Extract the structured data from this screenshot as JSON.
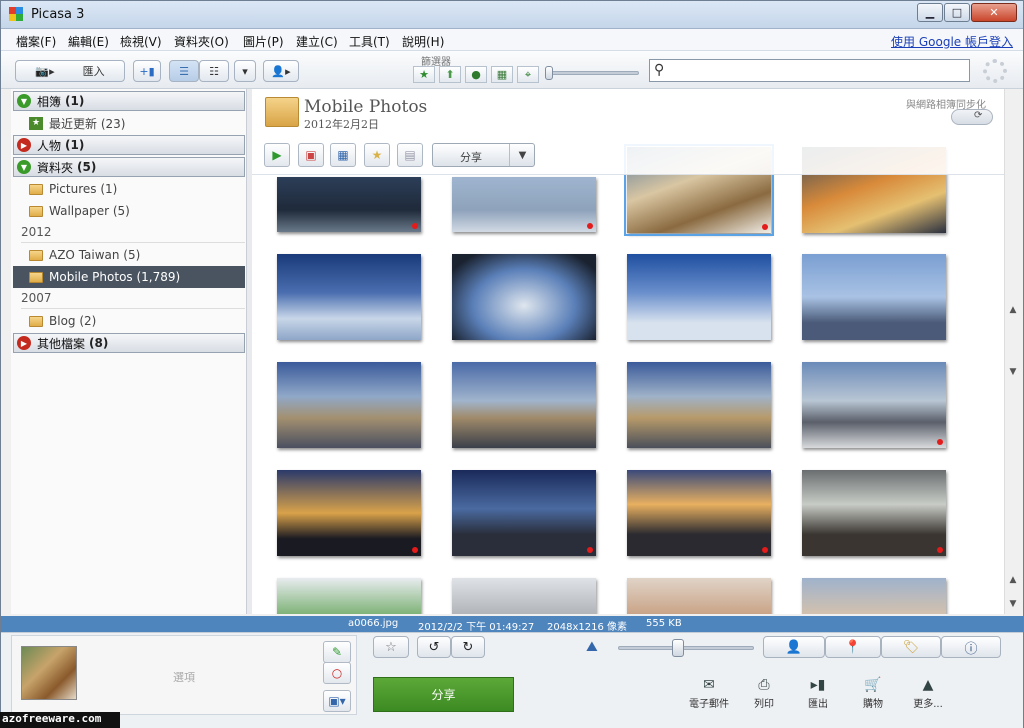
{
  "window": {
    "title": "Picasa 3",
    "controls": [
      "minimize",
      "maximize",
      "close"
    ]
  },
  "menu": {
    "items": [
      "檔案(F)",
      "編輯(E)",
      "檢視(V)",
      "資料夾(O)",
      "圖片(P)",
      "建立(C)",
      "工具(T)",
      "說明(H)"
    ],
    "login": "使用 Google 帳戶登入"
  },
  "toolbar": {
    "import_label": "匯入",
    "filter_label": "篩選器",
    "search_placeholder": "",
    "filter_icons": [
      "star-filter-icon",
      "upload-filter-icon",
      "person-filter-icon",
      "movie-filter-icon",
      "geotag-filter-icon"
    ]
  },
  "sidebar": {
    "sections": [
      {
        "label": "相簿",
        "count": "(1)",
        "expanded": true,
        "color": "#3a9a2a"
      },
      {
        "label": "人物",
        "count": "(1)",
        "expanded": false,
        "color": "#c42a1e"
      },
      {
        "label": "資料夾",
        "count": "(5)",
        "expanded": true,
        "color": "#3a9a2a"
      },
      {
        "label": "其他檔案",
        "count": "(8)",
        "expanded": false,
        "color": "#c42a1e"
      }
    ],
    "recent": "最近更新 (23)",
    "folders": [
      "Pictures (1)",
      "Wallpaper (5)"
    ],
    "years": [
      "2012",
      "2007"
    ],
    "folders_2012": [
      "AZO Taiwan (5)",
      "Mobile Photos (1,789)"
    ],
    "folders_2007": [
      "Blog (2)"
    ]
  },
  "album": {
    "title": "Mobile Photos",
    "date": "2012年2月2日",
    "sync_label": "與網路相簿同步化",
    "share_label": "分享"
  },
  "status": {
    "filename": "a0066.jpg",
    "datetime": "2012/2/2 下午 01:49:27",
    "dimensions": "2048x1216 像素",
    "size": "555 KB"
  },
  "bottom": {
    "tray_label": "選項",
    "share_label": "分享",
    "actions": [
      "電子郵件",
      "列印",
      "匯出",
      "購物",
      "更多..."
    ]
  },
  "watermark": "azofreeware.com",
  "colors": {
    "accent": "#4f85bd",
    "share_green": "#4c9a2f",
    "selected": "#4a5360"
  }
}
